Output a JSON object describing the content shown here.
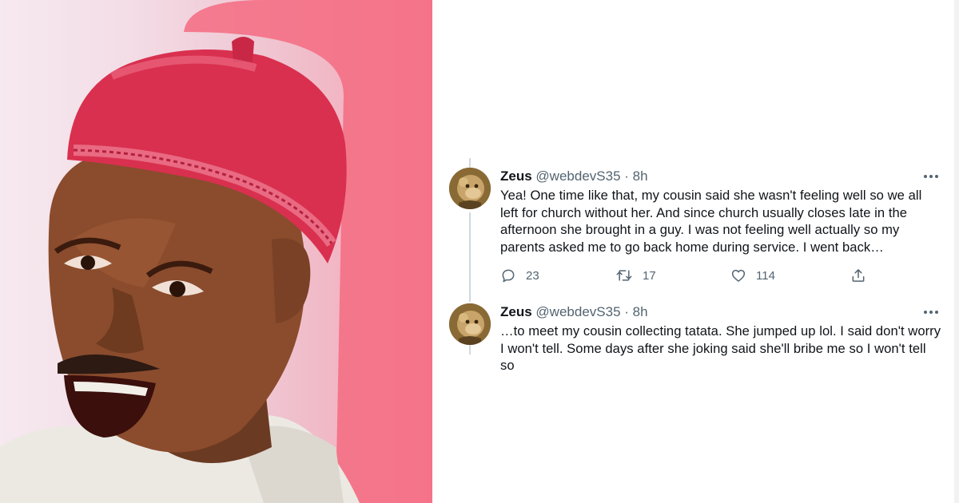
{
  "tweets": [
    {
      "name": "Zeus",
      "handle": "@webdevS35",
      "separator": "·",
      "time": "8h",
      "text": "Yea! One time like that, my cousin said she wasn't feeling well so we all left for church without her. And since church usually closes late in the afternoon she brought in a guy. I was not feeling well actually so my parents asked me to go back home during service. I went back…",
      "replies": "23",
      "retweets": "17",
      "likes": "114"
    },
    {
      "name": "Zeus",
      "handle": "@webdevS35",
      "separator": "·",
      "time": "8h",
      "text": "…to meet my cousin collecting tatata. She jumped up lol. I said don't worry I won't tell. Some days after she joking said she'll bribe me so I won't tell so"
    }
  ],
  "icons": {
    "reply": "comment-bubble-icon",
    "retweet": "retweet-arrows-icon",
    "like": "heart-icon",
    "share": "share-upload-icon",
    "more": "more-dots-icon"
  },
  "colors": {
    "text": "#0f1419",
    "muted": "#536471",
    "thread_line": "#cfd9de",
    "cap_red": "#d9304f",
    "background_pink": "#f5a3b2"
  }
}
